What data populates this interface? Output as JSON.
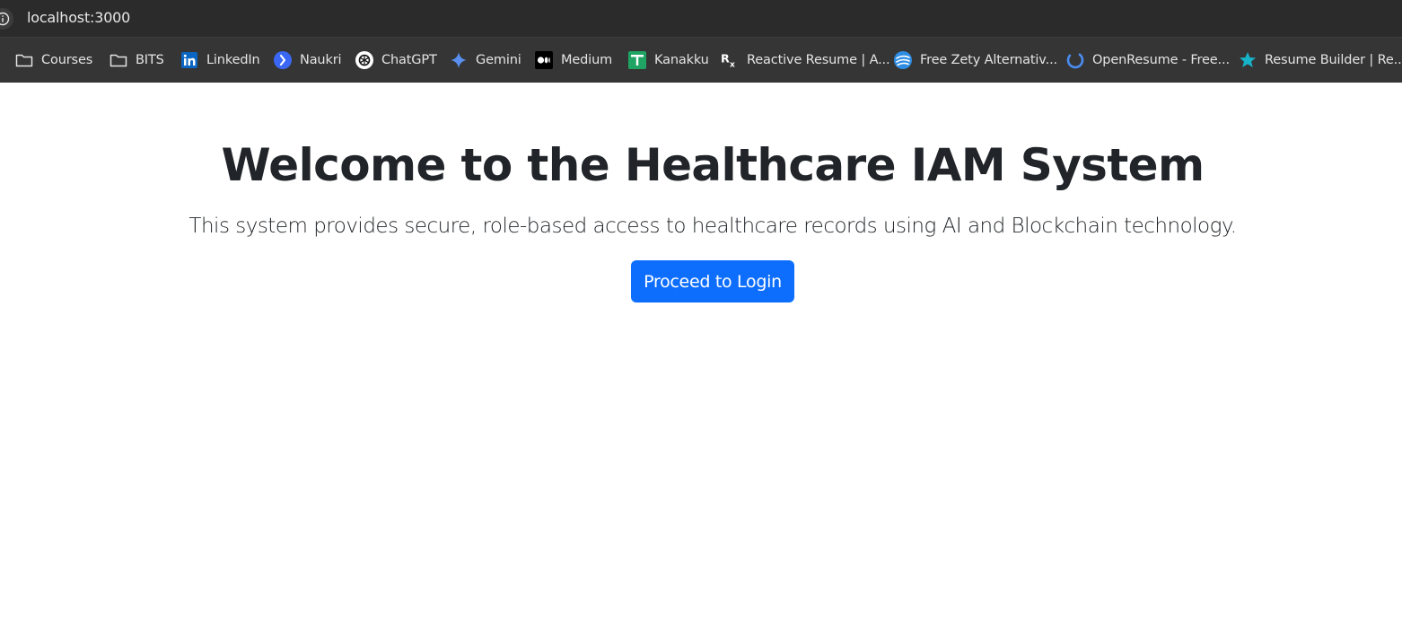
{
  "browser": {
    "url": "localhost:3000",
    "bookmarks": [
      {
        "label": "Courses",
        "icon": "folder-icon"
      },
      {
        "label": "BITS",
        "icon": "folder-icon"
      },
      {
        "label": "LinkedIn",
        "icon": "linkedin-icon"
      },
      {
        "label": "Naukri",
        "icon": "naukri-icon"
      },
      {
        "label": "ChatGPT",
        "icon": "chatgpt-icon"
      },
      {
        "label": "Gemini",
        "icon": "gemini-icon"
      },
      {
        "label": "Medium",
        "icon": "medium-icon"
      },
      {
        "label": "Kanakku",
        "icon": "kanakku-icon"
      },
      {
        "label": "Reactive Resume | A...",
        "icon": "reactive-resume-icon"
      },
      {
        "label": "Free Zety Alternativ...",
        "icon": "zety-alternative-icon"
      },
      {
        "label": "OpenResume - Free...",
        "icon": "openresume-icon"
      },
      {
        "label": "Resume Builder | Re...",
        "icon": "resume-builder-icon"
      }
    ]
  },
  "page": {
    "heading": "Welcome to the Healthcare IAM System",
    "lead": "This system provides secure, role-based access to healthcare records using AI and Blockchain technology.",
    "login_button": "Proceed to Login"
  },
  "colors": {
    "primary_button": "#0d6efd",
    "text": "#212529",
    "chrome_dark": "#2b2b2b",
    "bookmarks_bar": "#353535"
  }
}
